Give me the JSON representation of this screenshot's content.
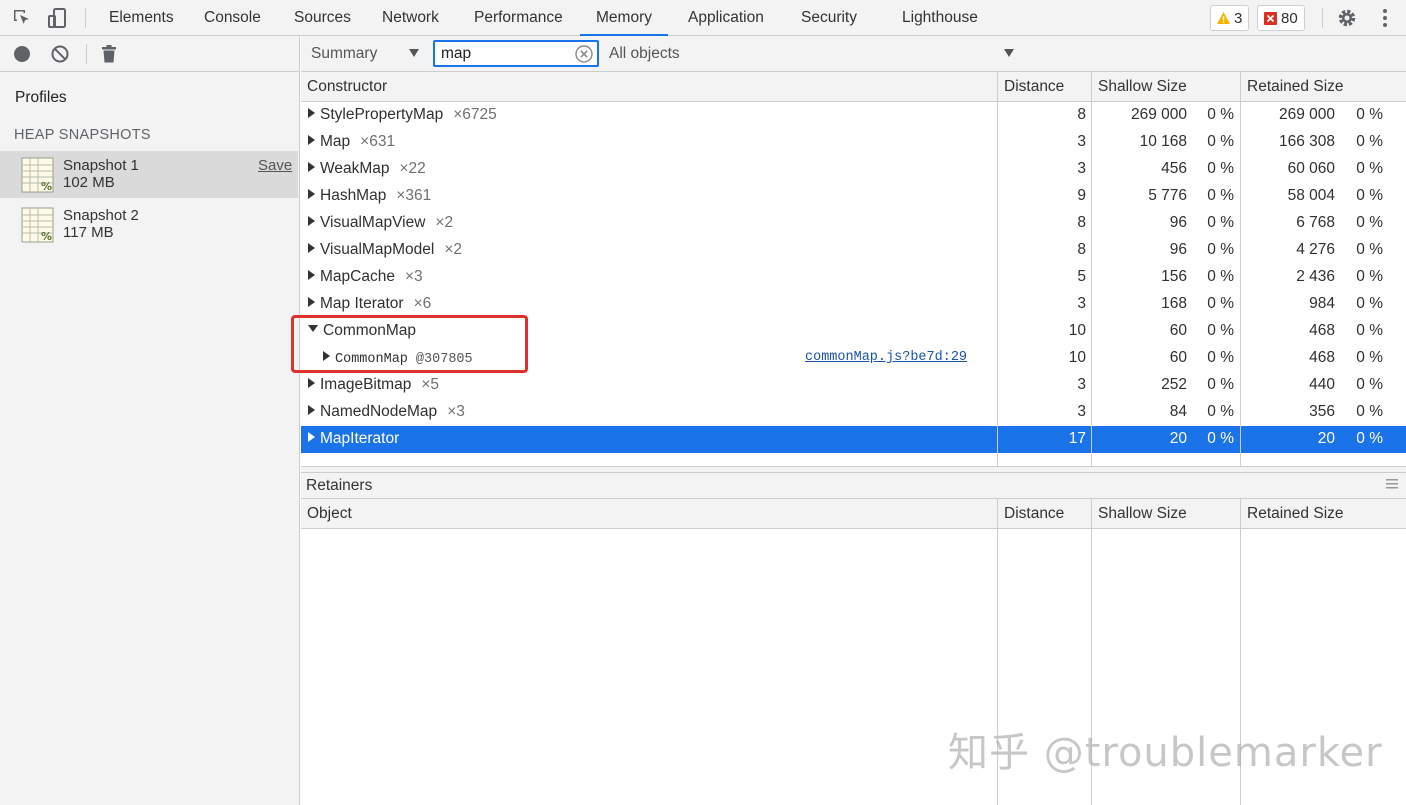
{
  "tabs": [
    "Elements",
    "Console",
    "Sources",
    "Network",
    "Performance",
    "Memory",
    "Application",
    "Security",
    "Lighthouse"
  ],
  "active_tab": "Memory",
  "badges": {
    "warnings": "3",
    "errors": "80"
  },
  "colors": {
    "accent": "#1a73e8",
    "highlight": "#e0302a",
    "warning": "#f4b400",
    "error": "#d93025"
  },
  "sidebar": {
    "profiles_label": "Profiles",
    "section_label": "HEAP SNAPSHOTS",
    "snapshots": [
      {
        "name": "Snapshot 1",
        "size": "102 MB",
        "save_label": "Save"
      },
      {
        "name": "Snapshot 2",
        "size": "117 MB"
      }
    ]
  },
  "toolbar": {
    "view": "Summary",
    "filter_value": "map",
    "objects_filter": "All objects"
  },
  "table": {
    "headers": {
      "constructor": "Constructor",
      "distance": "Distance",
      "shallow": "Shallow Size",
      "retained": "Retained Size"
    },
    "rows": [
      {
        "name": "StylePropertyMap",
        "count": "×6725",
        "distance": "8",
        "shallow": "269 000",
        "shallow_pct": "0 %",
        "retained": "269 000",
        "retained_pct": "0 %"
      },
      {
        "name": "Map",
        "count": "×631",
        "distance": "3",
        "shallow": "10 168",
        "shallow_pct": "0 %",
        "retained": "166 308",
        "retained_pct": "0 %"
      },
      {
        "name": "WeakMap",
        "count": "×22",
        "distance": "3",
        "shallow": "456",
        "shallow_pct": "0 %",
        "retained": "60 060",
        "retained_pct": "0 %"
      },
      {
        "name": "HashMap",
        "count": "×361",
        "distance": "9",
        "shallow": "5 776",
        "shallow_pct": "0 %",
        "retained": "58 004",
        "retained_pct": "0 %"
      },
      {
        "name": "VisualMapView",
        "count": "×2",
        "distance": "8",
        "shallow": "96",
        "shallow_pct": "0 %",
        "retained": "6 768",
        "retained_pct": "0 %"
      },
      {
        "name": "VisualMapModel",
        "count": "×2",
        "distance": "8",
        "shallow": "96",
        "shallow_pct": "0 %",
        "retained": "4 276",
        "retained_pct": "0 %"
      },
      {
        "name": "MapCache",
        "count": "×3",
        "distance": "5",
        "shallow": "156",
        "shallow_pct": "0 %",
        "retained": "2 436",
        "retained_pct": "0 %"
      },
      {
        "name": "Map Iterator",
        "count": "×6",
        "distance": "3",
        "shallow": "168",
        "shallow_pct": "0 %",
        "retained": "984",
        "retained_pct": "0 %"
      },
      {
        "name": "CommonMap",
        "count": "",
        "distance": "10",
        "shallow": "60",
        "shallow_pct": "0 %",
        "retained": "468",
        "retained_pct": "0 %"
      },
      {
        "name": "CommonMap",
        "address": "@307805",
        "link": "commonMap.js?be7d:29",
        "distance": "10",
        "shallow": "60",
        "shallow_pct": "0 %",
        "retained": "468",
        "retained_pct": "0 %"
      },
      {
        "name": "ImageBitmap",
        "count": "×5",
        "distance": "3",
        "shallow": "252",
        "shallow_pct": "0 %",
        "retained": "440",
        "retained_pct": "0 %"
      },
      {
        "name": "NamedNodeMap",
        "count": "×3",
        "distance": "3",
        "shallow": "84",
        "shallow_pct": "0 %",
        "retained": "356",
        "retained_pct": "0 %"
      },
      {
        "name": "MapIterator",
        "count": "",
        "distance": "17",
        "shallow": "20",
        "shallow_pct": "0 %",
        "retained": "20",
        "retained_pct": "0 %"
      }
    ]
  },
  "retainers": {
    "title": "Retainers",
    "headers": {
      "object": "Object",
      "distance": "Distance",
      "shallow": "Shallow Size",
      "retained": "Retained Size"
    }
  },
  "watermark": "知乎 @troublemarker"
}
